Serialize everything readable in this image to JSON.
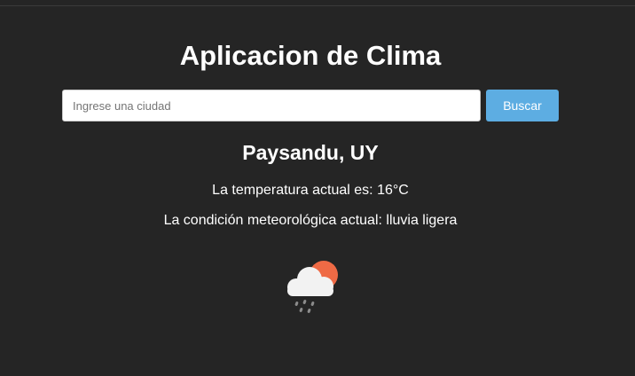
{
  "header": {
    "title": "Aplicacion de Clima"
  },
  "search": {
    "placeholder": "Ingrese una ciudad",
    "value": "",
    "button_label": "Buscar"
  },
  "weather": {
    "city": "Paysandu, UY",
    "temperature_label": "La temperatura actual es:",
    "temperature_value": "16°C",
    "condition_label": "La condición meteorológica actual:",
    "condition_value": "lluvia ligera",
    "icon": "cloud-sun-rain-icon"
  },
  "colors": {
    "background": "#252525",
    "button": "#5dade2",
    "sun": "#ef6a45",
    "cloud": "#f2f2f2",
    "rain": "#8c8c8c"
  }
}
